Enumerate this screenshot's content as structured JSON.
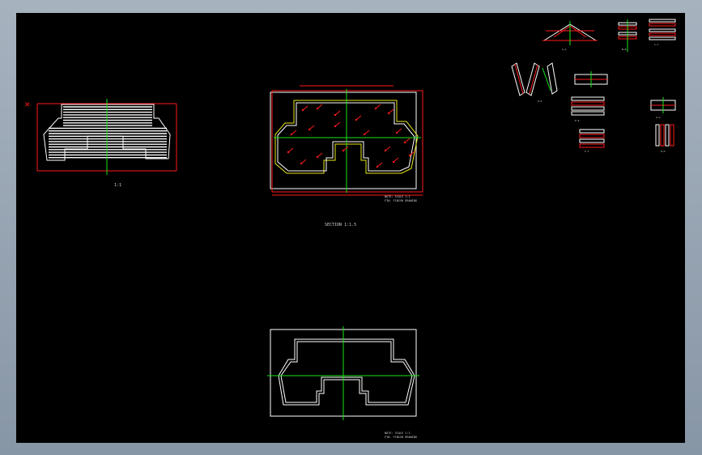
{
  "viewer": {
    "background": "#000000",
    "frame_color": "#8e9aa8"
  },
  "colors": {
    "outline": "#ffffff",
    "dimension": "#ff1a1a",
    "centerline": "#19e619",
    "hatch": "#e6e619"
  },
  "drawing": {
    "elevation_label": "1:1",
    "plan_title": "SECTION  1:1.5",
    "plan_note": "NOTE: SCALE 1:1",
    "plan_note_2": "FIN. FINISH DRAWING",
    "lower_note": "NOTE: SCALE 1:1",
    "lower_note_2": "FIN. FINISH DRAWING",
    "detail_labels": [
      "A-A",
      "B-B",
      "C-C",
      "D-D",
      "E-E",
      "F-F",
      "G-G",
      "H-H"
    ]
  }
}
